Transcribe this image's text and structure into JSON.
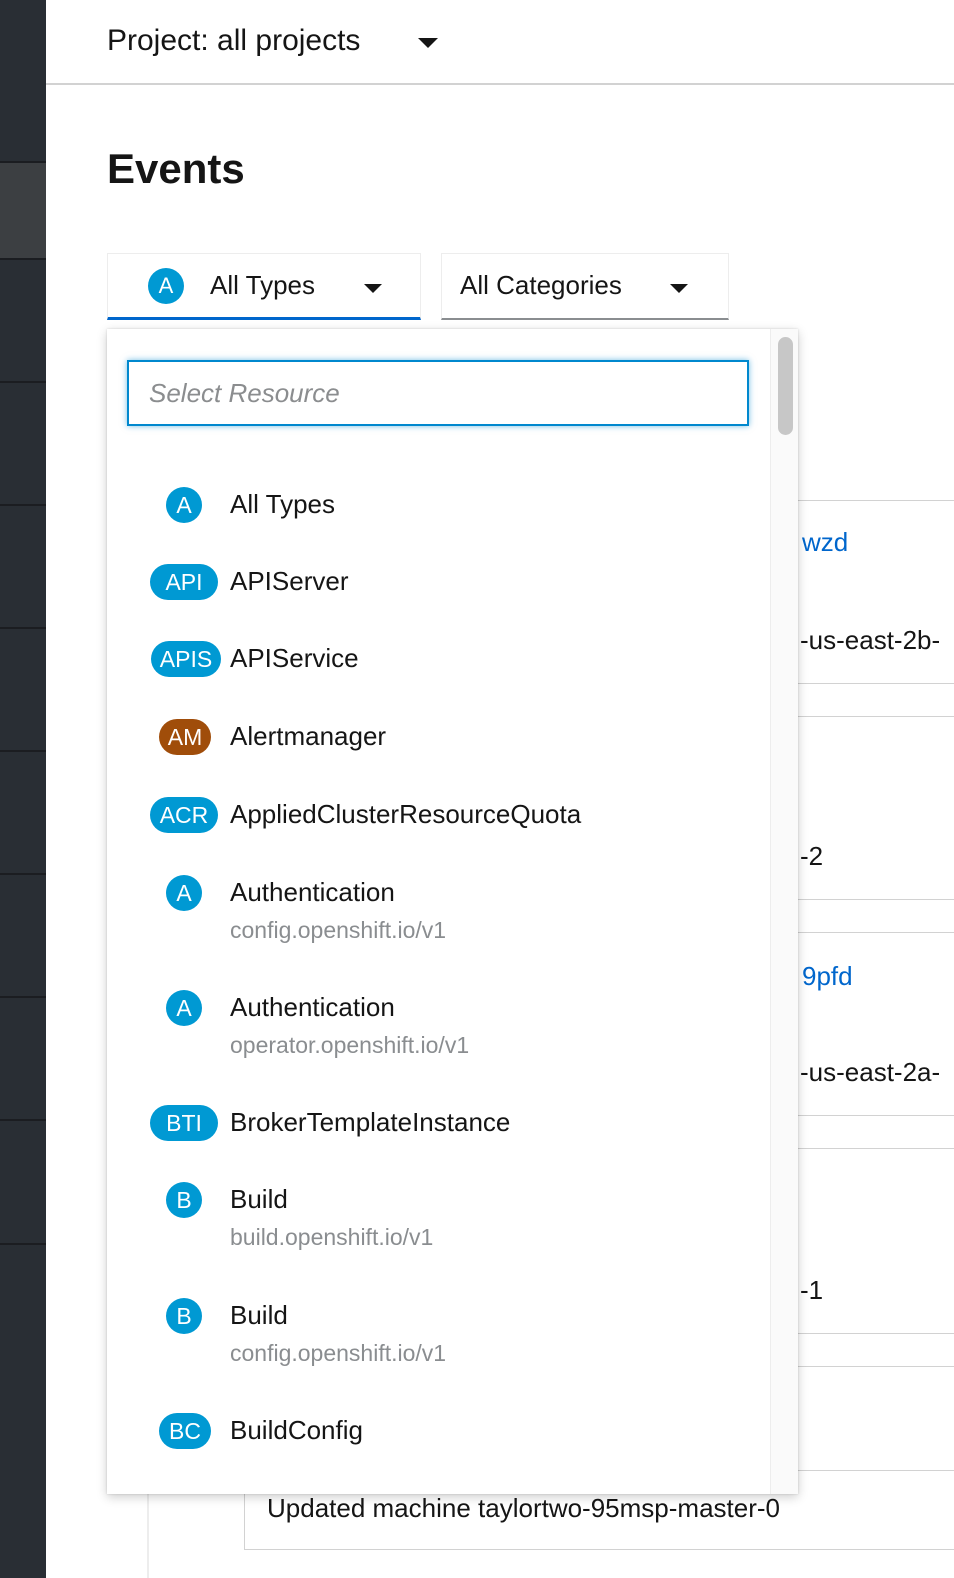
{
  "project_selector": {
    "label": "Project: all projects",
    "caret_icon": "caret-down-icon"
  },
  "page": {
    "title": "Events"
  },
  "filters": {
    "type": {
      "badge": "A",
      "label": "All Types",
      "badge_color": "#0099d3"
    },
    "category": {
      "label": "All Categories"
    }
  },
  "dropdown": {
    "search": {
      "placeholder": "Select Resource",
      "value": ""
    },
    "options": [
      {
        "badge": "A",
        "color": "#0099d3",
        "title": "All Types",
        "subtitle": ""
      },
      {
        "badge": "API",
        "color": "#0099d3",
        "title": "APIServer",
        "subtitle": ""
      },
      {
        "badge": "APIS",
        "color": "#0099d3",
        "title": "APIService",
        "subtitle": ""
      },
      {
        "badge": "AM",
        "color": "#a04d0a",
        "title": "Alertmanager",
        "subtitle": ""
      },
      {
        "badge": "ACR",
        "color": "#0099d3",
        "title": "AppliedClusterResourceQuota",
        "subtitle": ""
      },
      {
        "badge": "A",
        "color": "#0099d3",
        "title": "Authentication",
        "subtitle": "config.openshift.io/v1"
      },
      {
        "badge": "A",
        "color": "#0099d3",
        "title": "Authentication",
        "subtitle": "operator.openshift.io/v1"
      },
      {
        "badge": "BTI",
        "color": "#0099d3",
        "title": "BrokerTemplateInstance",
        "subtitle": ""
      },
      {
        "badge": "B",
        "color": "#0099d3",
        "title": "Build",
        "subtitle": "build.openshift.io/v1"
      },
      {
        "badge": "B",
        "color": "#0099d3",
        "title": "Build",
        "subtitle": "config.openshift.io/v1"
      },
      {
        "badge": "BC",
        "color": "#0099d3",
        "title": "BuildConfig",
        "subtitle": ""
      }
    ]
  },
  "background_events": {
    "card1": {
      "link": "wzd",
      "text": "-us-east-2b-"
    },
    "card2": {
      "text": "-2"
    },
    "card3": {
      "link": "9pfd",
      "text": "-us-east-2a-"
    },
    "card4": {
      "text": "-1"
    },
    "card5": {
      "text": "Updated machine taylortwo-95msp-master-0"
    }
  }
}
